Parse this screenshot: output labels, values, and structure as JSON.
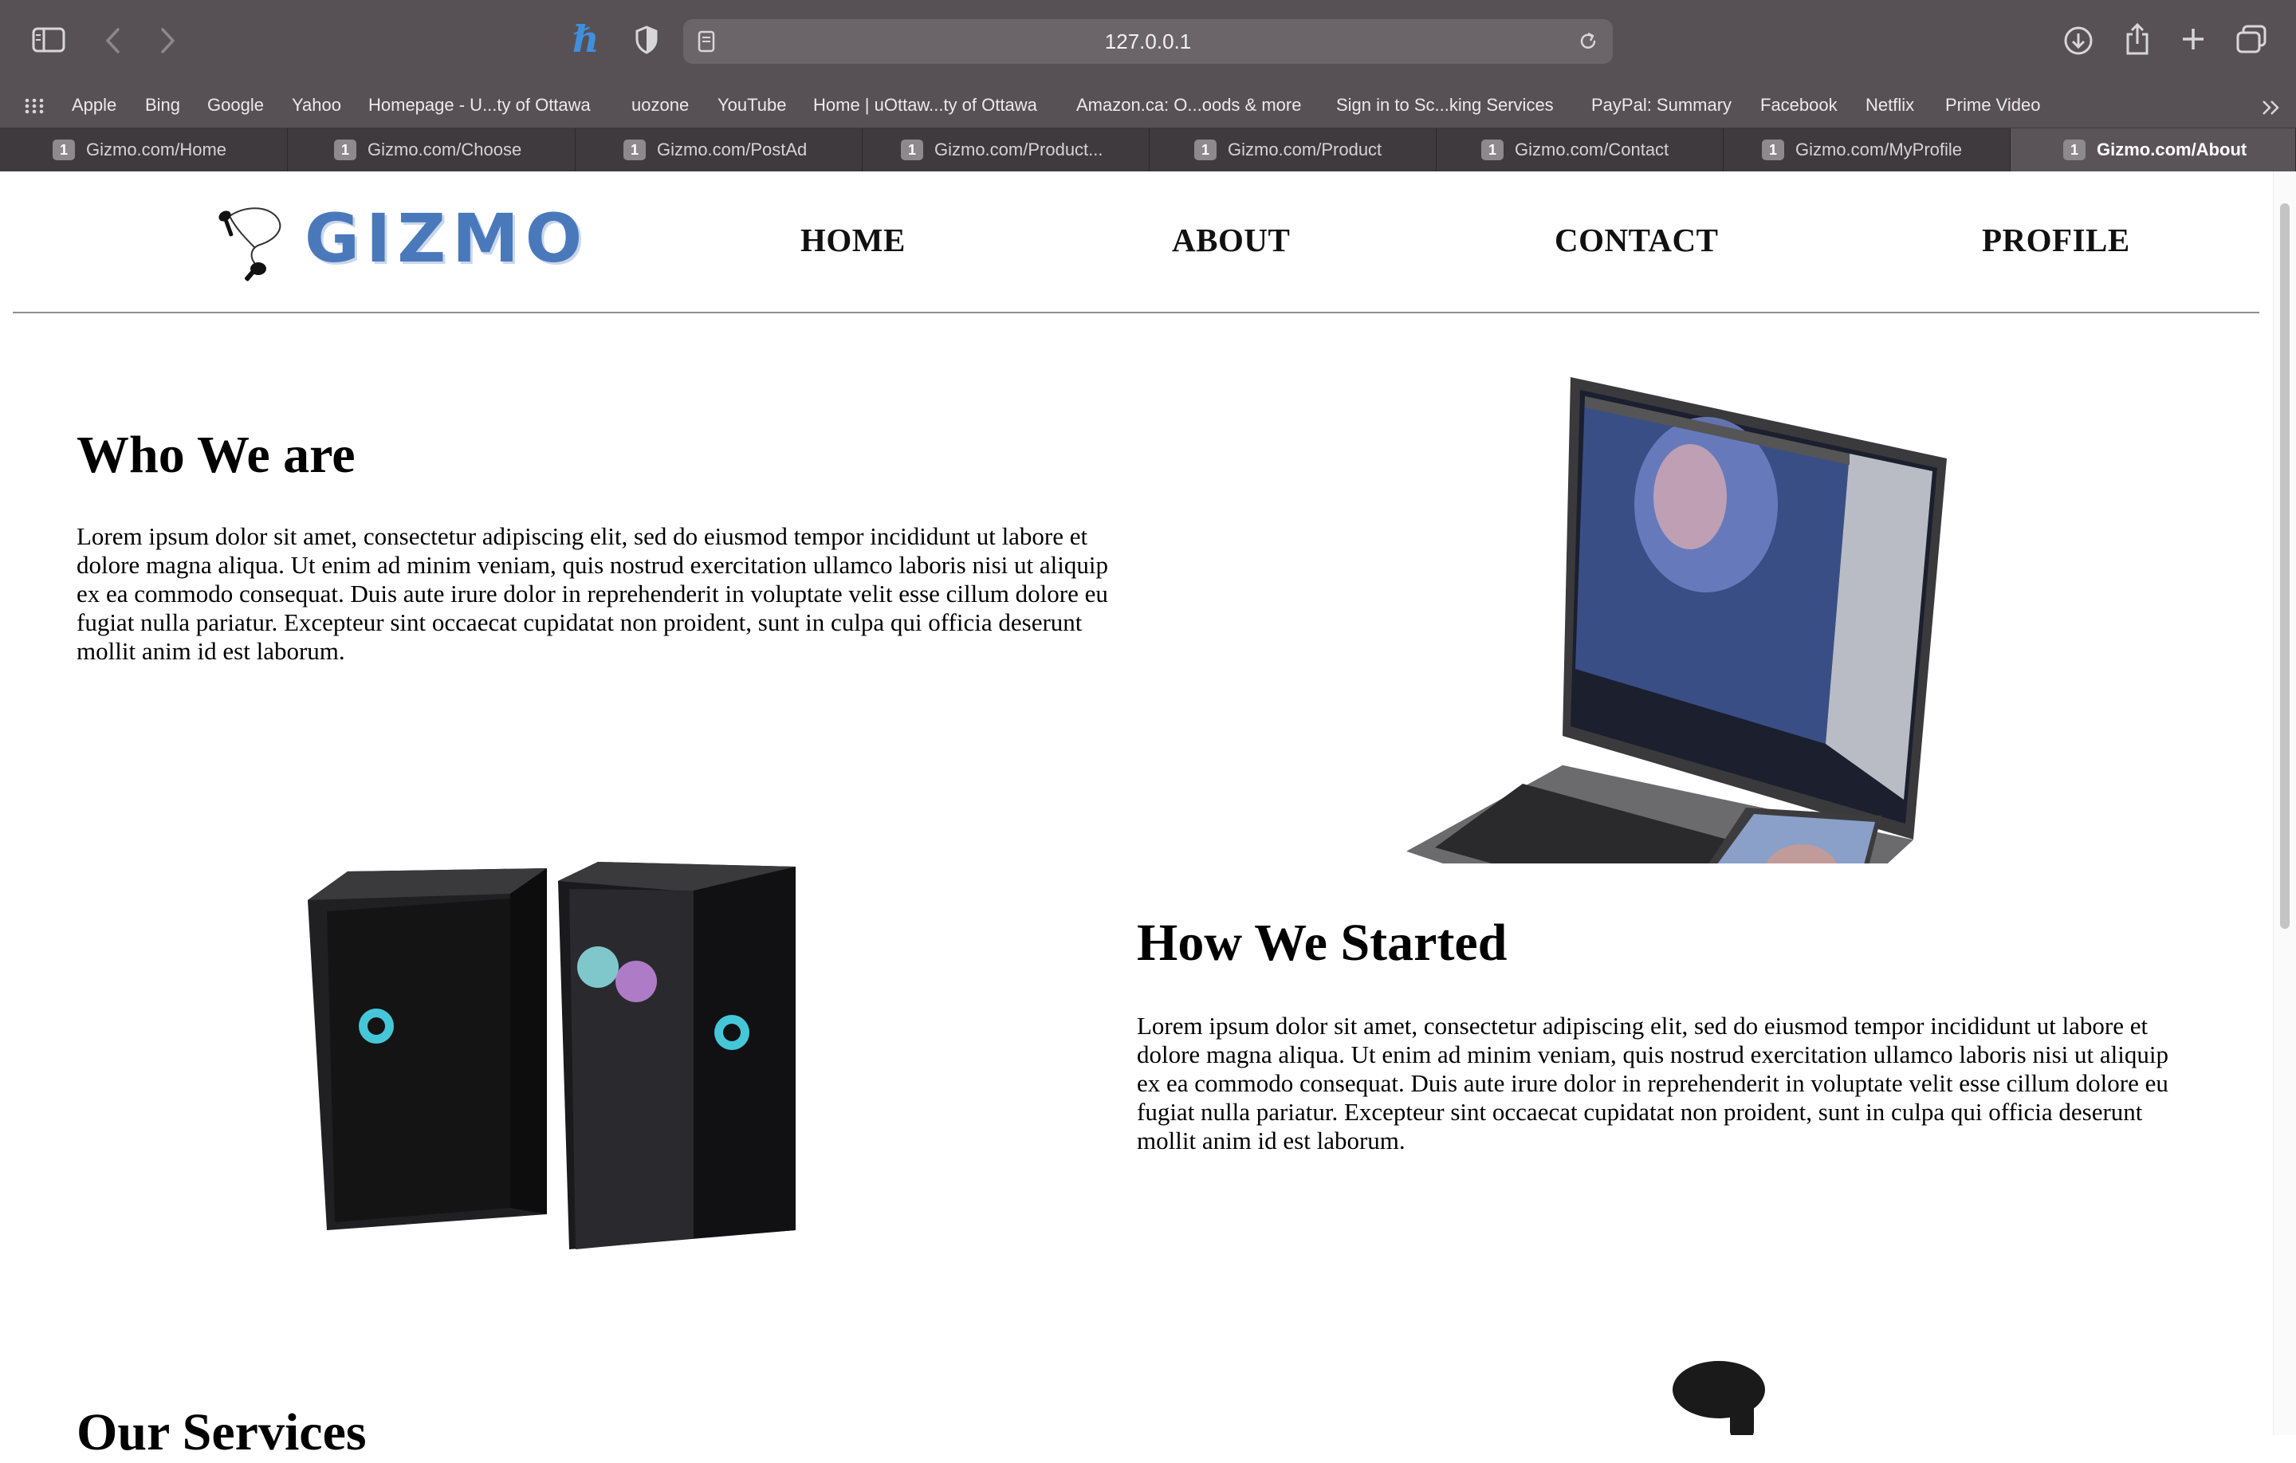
{
  "browser": {
    "url": "127.0.0.1",
    "bookmarks": [
      "Apple",
      "Bing",
      "Google",
      "Yahoo",
      "Homepage - U...ty of Ottawa",
      "uozone",
      "YouTube",
      "Home | uOttaw...ty of Ottawa",
      "Amazon.ca: O...oods & more",
      "Sign in to Sc...king Services",
      "PayPal: Summary",
      "Facebook",
      "Netflix",
      "Prime Video"
    ],
    "tabs": [
      {
        "count": "1",
        "title": "Gizmo.com/Home"
      },
      {
        "count": "1",
        "title": "Gizmo.com/Choose"
      },
      {
        "count": "1",
        "title": "Gizmo.com/PostAd"
      },
      {
        "count": "1",
        "title": "Gizmo.com/Product..."
      },
      {
        "count": "1",
        "title": "Gizmo.com/Product"
      },
      {
        "count": "1",
        "title": "Gizmo.com/Contact"
      },
      {
        "count": "1",
        "title": "Gizmo.com/MyProfile"
      },
      {
        "count": "1",
        "title": "Gizmo.com/About"
      }
    ],
    "active_tab": 7
  },
  "site": {
    "logo_text": "GIZMO",
    "nav": [
      "HOME",
      "ABOUT",
      "CONTACT",
      "PROFILE"
    ]
  },
  "sections": {
    "who": {
      "title": "Who We are",
      "body": "Lorem ipsum dolor sit amet, consectetur adipiscing elit, sed do eiusmod tempor incididunt ut labore et dolore magna aliqua. Ut enim ad minim veniam, quis nostrud exercitation ullamco laboris nisi ut aliquip ex ea commodo consequat. Duis aute irure dolor in reprehenderit in voluptate velit esse cillum dolore eu fugiat nulla pariatur. Excepteur sint occaecat cupidatat non proident, sunt in culpa qui officia deserunt mollit anim id est laborum."
    },
    "how": {
      "title": "How We Started",
      "body": "Lorem ipsum dolor sit amet, consectetur adipiscing elit, sed do eiusmod tempor incididunt ut labore et dolore magna aliqua. Ut enim ad minim veniam, quis nostrud exercitation ullamco laboris nisi ut aliquip ex ea commodo consequat. Duis aute irure dolor in reprehenderit in voluptate velit esse cillum dolore eu fugiat nulla pariatur. Excepteur sint occaecat cupidatat non proident, sunt in culpa qui officia deserunt mollit anim id est laborum."
    },
    "services": {
      "title": "Our Services"
    }
  },
  "colors": {
    "brand": "#4a79bb",
    "chrome": "#575155",
    "tab_bar": "#3f3a3d"
  }
}
